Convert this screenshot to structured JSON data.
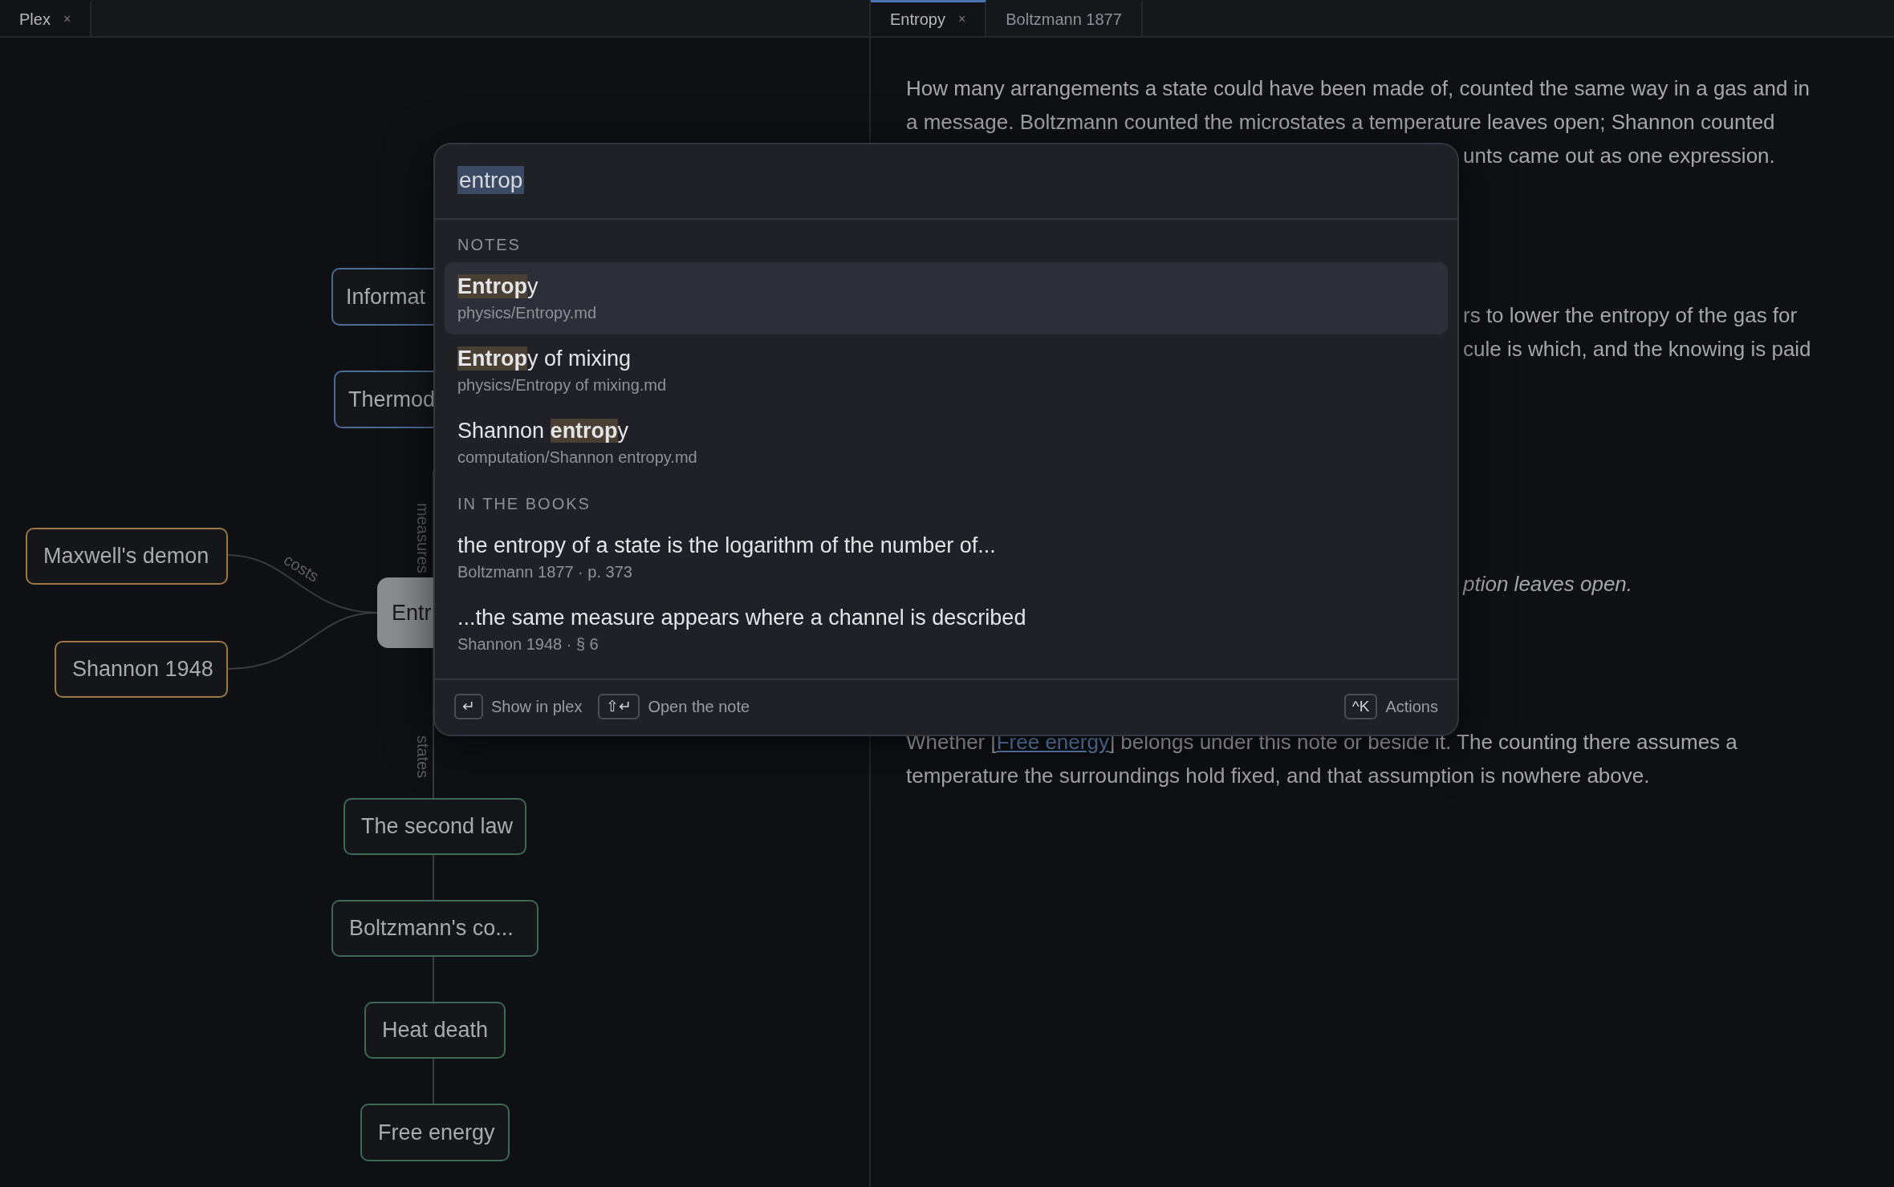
{
  "left_tabs": [
    {
      "label": "Plex",
      "close": "×",
      "selected": true
    }
  ],
  "right_tabs": [
    {
      "label": "Entropy",
      "close": "×",
      "selected": true
    },
    {
      "label": "Boltzmann 1877",
      "selected": false
    }
  ],
  "graph": {
    "nodes": [
      {
        "label": "Informat",
        "color": "#4d6d96",
        "selected": false
      },
      {
        "label": "Thermod",
        "color": "#4d6d96",
        "selected": false
      },
      {
        "label": "Maxwell's demon",
        "color": "#9c7748",
        "selected": false
      },
      {
        "label": "Shannon 1948",
        "color": "#9c7748",
        "selected": false
      },
      {
        "label": "Entr",
        "color": "#8c8d90",
        "selected": true
      },
      {
        "label": "The second law",
        "color": "#3d6a55",
        "selected": false
      },
      {
        "label": "Boltzmann's co...",
        "color": "#3d6a55",
        "selected": false
      },
      {
        "label": "Heat death",
        "color": "#3d6a55",
        "selected": false
      },
      {
        "label": "Free energy",
        "color": "#3d6a55",
        "selected": false
      }
    ],
    "edge_labels": [
      "costs",
      "measures",
      "states"
    ]
  },
  "note": {
    "paragraphs": [
      {
        "kind": "plain",
        "lines": [
          "How many arrangements a state could have been made of, counted the same way in a gas and in",
          "a message. Boltzmann counted the microstates a temperature leaves open; Shannon counted"
        ],
        "tail": [
          "unts came out as one expression."
        ]
      },
      {
        "kind": "plain",
        "tail": [
          "rs to lower the entropy of the gas for",
          "cule is which, and the knowing is paid"
        ]
      },
      {
        "kind": "italic",
        "tail": [
          "ption leaves open."
        ]
      },
      {
        "kind": "link",
        "before": "Whether [",
        "link": "Free energy",
        "after": "] belongs under this note or beside it. The counting there assumes a temperature the surroundings hold fixed, and that assumption is nowhere above."
      }
    ]
  },
  "palette": {
    "query": "entrop",
    "sections": [
      {
        "heading": "NOTES",
        "items": [
          {
            "title": "**Entrop**y",
            "detail": "physics/Entropy.md",
            "selected": true
          },
          {
            "title": "**Entrop**y of mixing",
            "detail": "physics/Entropy of mixing.md",
            "selected": false
          },
          {
            "title": "Shannon **entrop**y",
            "detail": "computation/Shannon entropy.md",
            "selected": false
          }
        ]
      },
      {
        "heading": "IN THE BOOKS",
        "items": [
          {
            "title": "the entropy of a state is the logarithm of the number of...",
            "detail": "Boltzmann 1877 · p. 373",
            "selected": false
          },
          {
            "title": "...the same measure appears where a channel is described",
            "detail": "Shannon 1948 · § 6",
            "selected": false
          }
        ]
      }
    ],
    "footer": [
      {
        "key": "↵",
        "label": "Show in plex"
      },
      {
        "key": "⇧↵",
        "label": "Open the note"
      },
      {
        "key": "^K",
        "label": "Actions"
      }
    ]
  }
}
